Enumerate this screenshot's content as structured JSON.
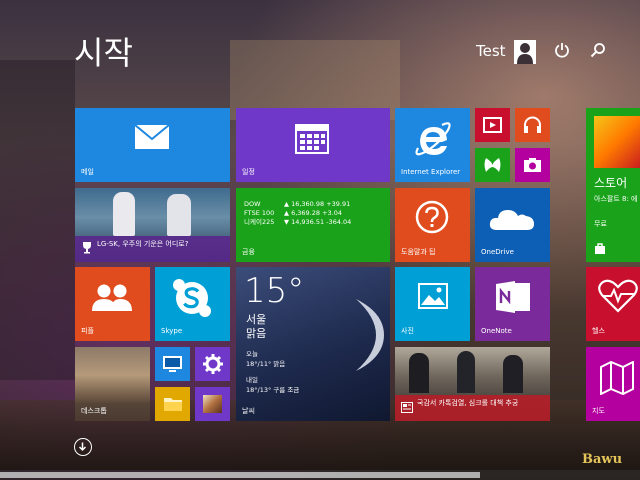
{
  "header": {
    "title": "시작",
    "user_name": "Test"
  },
  "tiles": {
    "mail": {
      "label": "메일"
    },
    "calendar": {
      "label": "일정"
    },
    "ie": {
      "label": "Internet Explorer"
    },
    "sports": {
      "caption": "LG-SK, 우주의 기운은 어디로?"
    },
    "finance": {
      "label": "금융",
      "stocks": [
        {
          "name": "DOW",
          "value": "▲ 16,360.98 +39.91"
        },
        {
          "name": "FTSE 100",
          "value": "▲ 6,369.28 +3.04"
        },
        {
          "name": "니케이225",
          "value": "▼ 14,936.51 -364.04"
        }
      ]
    },
    "help": {
      "label": "도움말과 팁"
    },
    "onedrive": {
      "label": "OneDrive"
    },
    "people": {
      "label": "피플"
    },
    "skype": {
      "label": "Skype"
    },
    "weather": {
      "label": "날씨",
      "temp": "15°",
      "city": "서울",
      "condition": "맑음",
      "today_label": "오늘",
      "today": "18°/11° 맑음",
      "tomorrow_label": "내일",
      "tomorrow": "18°/13° 구름 조금"
    },
    "photos": {
      "label": "사진"
    },
    "onenote": {
      "label": "OneNote"
    },
    "desktop": {
      "label": "데스크톱"
    },
    "news": {
      "caption": "국감서 카톡검열, 심크롤 대책 추궁"
    },
    "store": {
      "title": "스토어",
      "subtitle": "아스팔트 8: 에",
      "price": "무료"
    },
    "health": {
      "label": "헬스"
    },
    "maps": {
      "label": "지도"
    }
  },
  "watermark": "Bawu",
  "colors": {
    "blue": "#1e88e0",
    "purple": "#7038c8",
    "green": "#1aa31a",
    "orange": "#e04c1e",
    "red": "#c8102e",
    "teal": "#00a0d6",
    "onedrive": "#0d5fb5",
    "onenote": "#7b2a9b",
    "magenta": "#b4009e"
  }
}
